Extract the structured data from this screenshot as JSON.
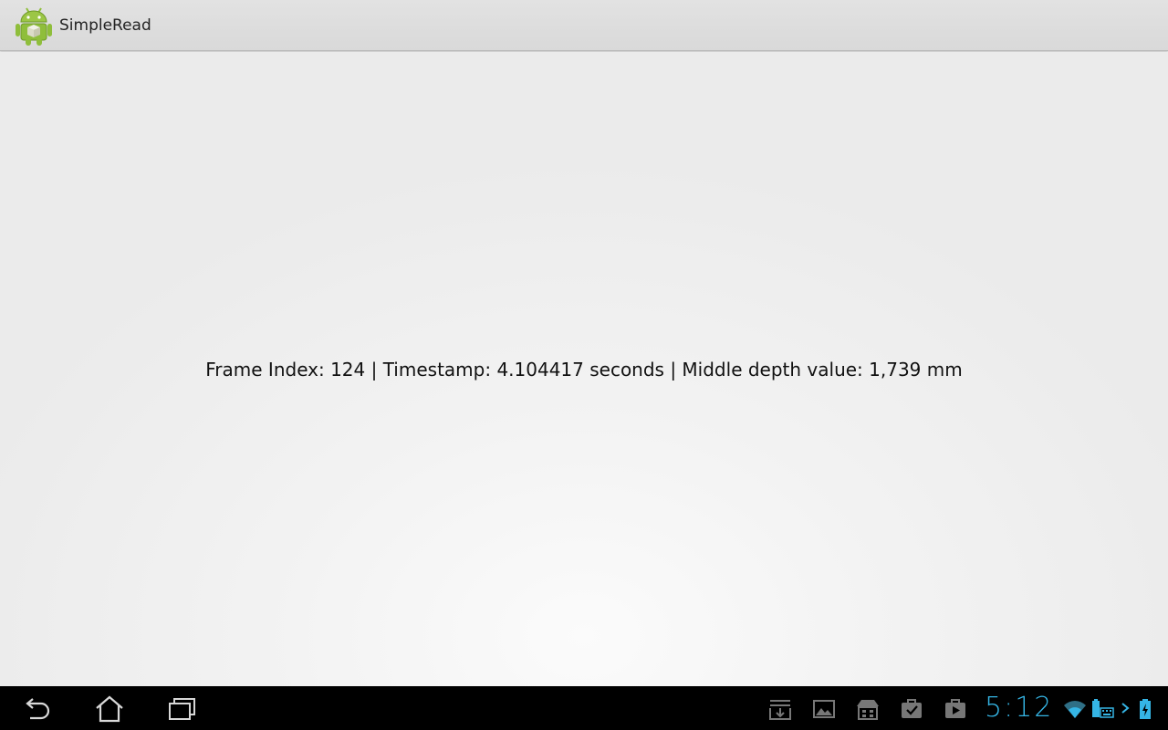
{
  "app": {
    "title": "SimpleRead",
    "icon": "android-robot-icon"
  },
  "main": {
    "status_text": "Frame Index: 124 | Timestamp: 4.104417 seconds | Middle depth value: 1,739 mm"
  },
  "system_bar": {
    "nav": [
      "back-icon",
      "home-icon",
      "recent-apps-icon"
    ],
    "notifications": [
      "download-icon",
      "gallery-icon",
      "store-icon",
      "task-check-icon",
      "play-store-icon"
    ],
    "clock": "5:12",
    "status_icons": [
      "wifi-icon",
      "battery-icon",
      "keyboard-icon",
      "chevron-icon",
      "charging-battery-icon"
    ]
  },
  "colors": {
    "action_bar": "#dcdcdc",
    "content_bg": "#f1f1f1",
    "system_bar": "#000000",
    "clock": "#35b5e5",
    "android_green": "#8fbe3b"
  }
}
